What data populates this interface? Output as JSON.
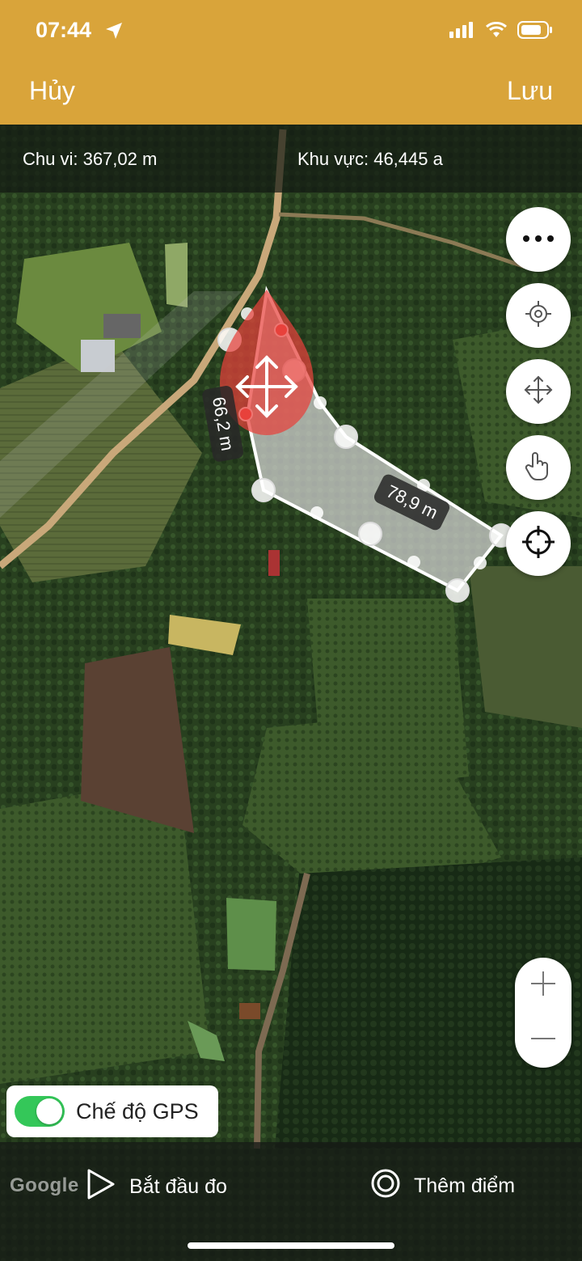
{
  "status": {
    "time": "07:44",
    "icons": [
      "location-arrow-icon",
      "signal-icon",
      "wifi-icon",
      "battery-icon"
    ]
  },
  "header": {
    "cancel_label": "Hủy",
    "save_label": "Lưu",
    "background": "#d9a43a"
  },
  "info": {
    "perimeter": "Chu vi: 367,02 m",
    "area": "Khu vực: 46,445 a"
  },
  "measurements": {
    "segment_left": "66,2 m",
    "segment_right": "78,9 m"
  },
  "controls": {
    "more": "more-icon",
    "locate": "locate-icon",
    "move": "move-icon",
    "touch": "touch-icon",
    "crosshair": "crosshair-icon",
    "zoom_in": "+",
    "zoom_out": "−"
  },
  "gps": {
    "label": "Chế độ GPS",
    "enabled": true
  },
  "bottom": {
    "start_label": "Bắt đầu đo",
    "add_point_label": "Thêm điểm",
    "map_attribution": "Google"
  },
  "colors": {
    "polygon_fill": "#dcdcdc",
    "selected_pin": "#e8413c",
    "toggle_on": "#34c759"
  }
}
